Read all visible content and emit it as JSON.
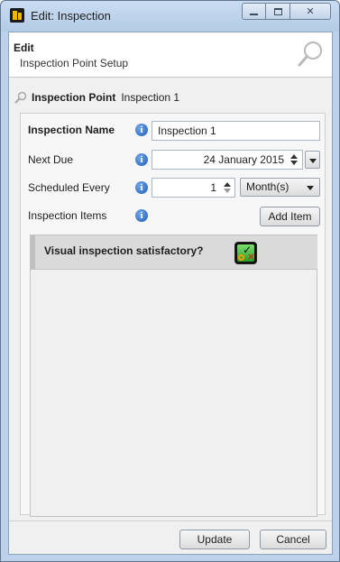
{
  "window": {
    "title": "Edit: Inspection",
    "caption_buttons": {
      "minimize": "minimize-icon",
      "maximize": "maximize-icon",
      "close": "close-icon",
      "close_glyph": "✕"
    }
  },
  "header": {
    "title": "Edit",
    "subtitle": "Inspection Point Setup",
    "icon": "magnifier-icon"
  },
  "inspection_point": {
    "label": "Inspection Point",
    "value": "Inspection 1"
  },
  "form": {
    "inspection_name": {
      "label": "Inspection Name",
      "value": "Inspection 1"
    },
    "next_due": {
      "label": "Next Due",
      "value": "24 January 2015"
    },
    "scheduled_every": {
      "label": "Scheduled Every",
      "value": "1",
      "unit": "Month(s)"
    },
    "inspection_items": {
      "label": "Inspection Items",
      "add_button": "Add Item"
    },
    "info_glyph": "i"
  },
  "items": [
    {
      "text": "Visual inspection satisfactory?",
      "icon": "pass-fail-icon"
    }
  ],
  "footer": {
    "update_label": "Update",
    "cancel_label": "Cancel"
  },
  "colors": {
    "window_frame": "#bcd1ea",
    "client_bg": "#f0f0f0",
    "item_bg": "#dadada",
    "info_icon": "#1f5fb8"
  }
}
